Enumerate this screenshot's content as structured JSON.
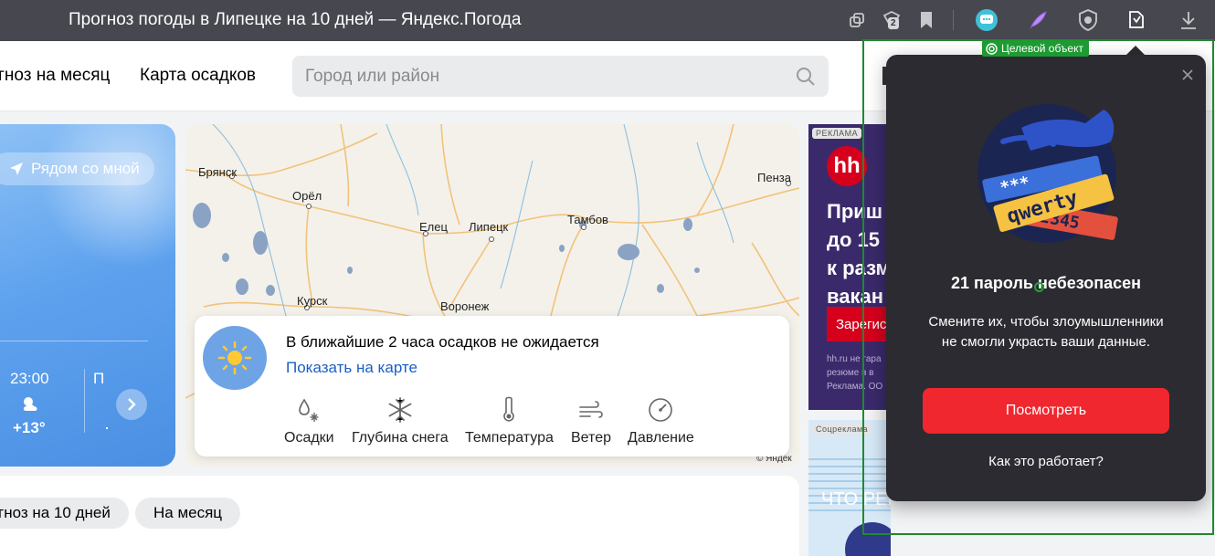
{
  "titlebar": {
    "title": "Прогноз погоды в Липецке на 10 дней — Яндекс.Погода",
    "tabs_badge": "2",
    "icons": [
      "collections-icon",
      "shield-tabs-icon",
      "bookmark-icon",
      "messenger-icon",
      "alice-feather-icon",
      "protect-icon",
      "password-manager-icon",
      "download-icon"
    ]
  },
  "header": {
    "nav": [
      "гноз на месяц",
      "Карта осадков"
    ],
    "search_placeholder": "Город или район"
  },
  "weather_card": {
    "near_button": "Рядом со мной",
    "hour_time": "23:00",
    "hour_temp": "+13°",
    "next_hour_fragment": "П"
  },
  "map": {
    "cities": [
      "Брянск",
      "Орёл",
      "Елец",
      "Липецк",
      "Тамбов",
      "Пенза",
      "Курск",
      "Воронеж"
    ],
    "copyright": "© Яндек"
  },
  "precip": {
    "title": "В ближайшие 2 часа осадков не ожидается",
    "link": "Показать на карте",
    "layers": [
      {
        "label": "Осадки",
        "icon": "precipitation-icon"
      },
      {
        "label": "Глубина снега",
        "icon": "snowflake-icon"
      },
      {
        "label": "Температура",
        "icon": "thermometer-icon"
      },
      {
        "label": "Ветер",
        "icon": "wind-icon"
      },
      {
        "label": "Давление",
        "icon": "pressure-gauge-icon"
      }
    ]
  },
  "forecast": {
    "tabs": [
      "гноз на 10 дней",
      "На месяц"
    ]
  },
  "ads": {
    "hh": {
      "tag": "РЕКЛАМА",
      "logo": "hh",
      "text": "Приш\nдо 15 \nк разм\nвакан",
      "button": "Зарегис",
      "small": "hh.ru не гара\nрезюме в в\nРеклама. ОО"
    },
    "social": {
      "tag": "Соцреклама",
      "text": "ЧТО РЕШЕНИЯ ПРИНИМАЕТЕ ВЫ."
    }
  },
  "target_label": "Целевой объект",
  "password_popup": {
    "illustration_words": [
      "***",
      "qwerty",
      "12345"
    ],
    "title": "21 пароль небезопасен",
    "body": "Смените их, чтобы злоумышленники не смогли украсть ваши данные.",
    "button": "Посмотреть",
    "how_link": "Как это работает?"
  },
  "colors": {
    "accent_red": "#f0272e",
    "link_blue": "#1a5fc4",
    "popup_bg": "#2b2b31",
    "target_green": "#1e8a2e"
  }
}
